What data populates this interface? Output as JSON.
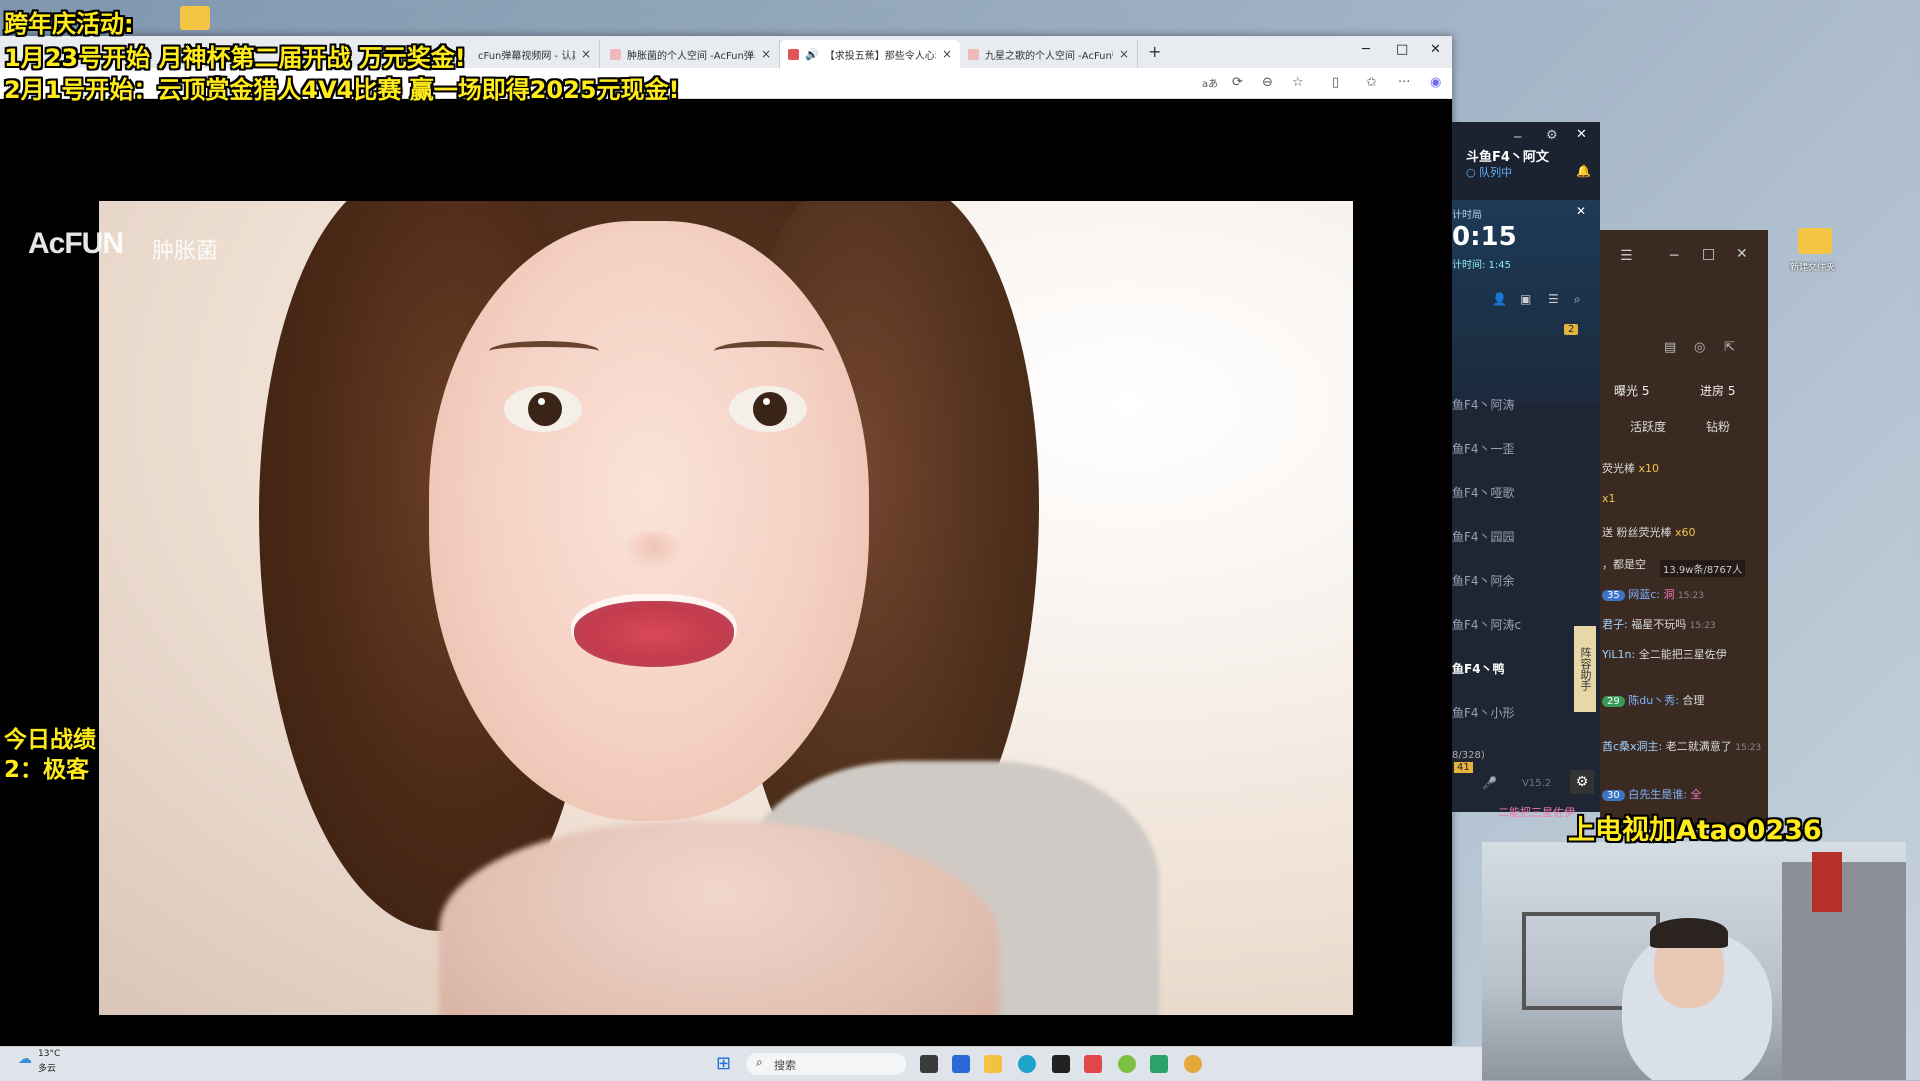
{
  "overlays": {
    "line1": "跨年庆活动:",
    "line2": "1月23号开始 月神杯第二届开战 万元奖金!",
    "line3": "2月1号开始：云顶赏金猎人4V4比赛 赢一场即得2025元现金!",
    "record_title": "今日战绩",
    "record_value": "2：极客",
    "cam_caption": "上电视加Atao0236"
  },
  "browser": {
    "tabs": [
      {
        "title": "cFun弹幕视频网 - 认真你"
      },
      {
        "title": "肿胀菌的个人空间 -AcFun弹幕视"
      },
      {
        "title": "【求投五蕉】那些令人心动"
      },
      {
        "title": "九星之歌的个人空间 -AcFun弹幕"
      }
    ],
    "new_tab": "+",
    "translate_icon": "aあ"
  },
  "video": {
    "watermark_logo": "AcFUN",
    "watermark_user": "肿胀菌"
  },
  "douyu": {
    "streamer": "斗鱼F4丶阿文",
    "status": "队列中",
    "timer_label": "计时局",
    "timer_value": "0:15",
    "timer_sub": "计时间: 1:45",
    "count_badge": "2",
    "members": [
      "鱼F4丶阿涛",
      "鱼F4丶一歪",
      "鱼F4丶哑歌",
      "鱼F4丶园园",
      "鱼F4丶阿余",
      "鱼F4丶阿涛c",
      "鱼F4丶鸭",
      "鱼F4丶小形"
    ],
    "group_count": "8/328)",
    "level": "41",
    "version": "V15.2",
    "helper": "阵容助手"
  },
  "chat": {
    "exposure": "曝光 5",
    "enter": "进房 5",
    "tab_active": "活跃度",
    "tab_fans": "钻粉",
    "gifts": [
      {
        "text": "荧光棒",
        "count": "x10"
      },
      {
        "text": "",
        "count": "x1"
      },
      {
        "text": "送 粉丝荧光棒",
        "count": "x60"
      }
    ],
    "stats": "13.9w条/8767人",
    "messages": [
      {
        "text": "，都是空"
      },
      {
        "badge": "35",
        "user": "网蓝c:",
        "msg": "洞",
        "time": "15:23"
      },
      {
        "user": "君子:",
        "msg": "福星不玩吗",
        "time": "15:23"
      },
      {
        "user": "YiL1n:",
        "msg": "全二能把三星佐伊"
      },
      {
        "badge": "29",
        "user": "陈du丶秀:",
        "msg": "合理"
      },
      {
        "user": "酋c桑x洞主:",
        "msg": "老二就满意了",
        "time": "15:23"
      },
      {
        "badge": "30",
        "user": "白先生是谁:",
        "msg": "全"
      },
      {
        "text": "二能把三星佐伊"
      }
    ]
  },
  "desktop": {
    "weather_temp": "13°C",
    "weather_desc": "多云",
    "search_placeholder": "搜索",
    "folder_label": "新建文件夹"
  }
}
